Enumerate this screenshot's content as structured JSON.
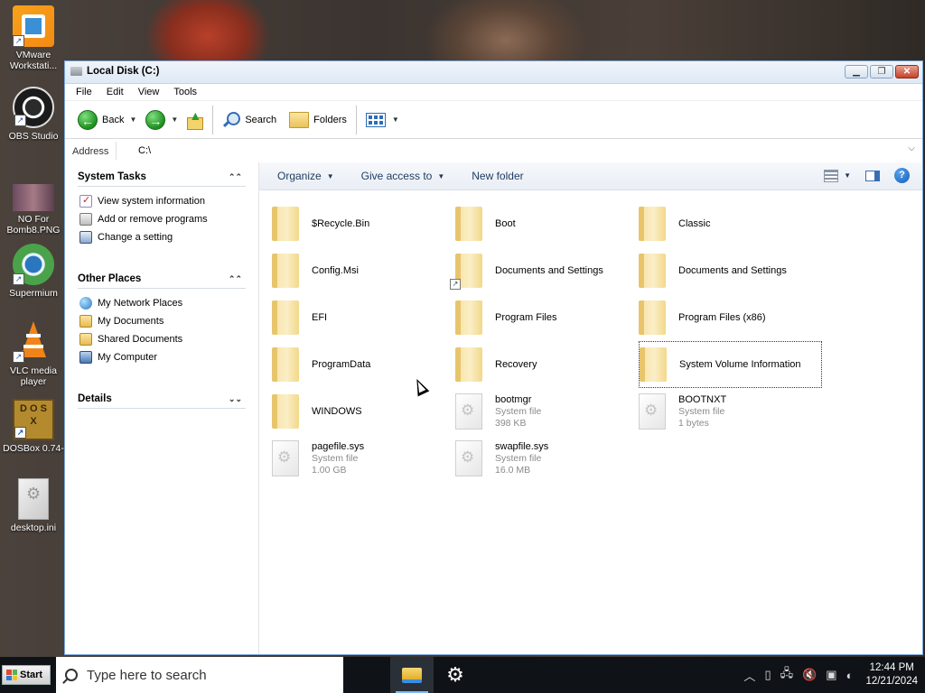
{
  "desktop": {
    "icons": [
      {
        "label": "VMware Workstati...",
        "icon": "vmware-icon"
      },
      {
        "label": "OBS Studio",
        "icon": "obs-icon"
      },
      {
        "label": "NO For Bomb8.PNG",
        "icon": "image-file-icon"
      },
      {
        "label": "Supermium",
        "icon": "supermium-icon"
      },
      {
        "label": "VLC media player",
        "icon": "vlc-icon"
      },
      {
        "label": "DOSBox 0.74-",
        "icon": "dosbox-icon"
      },
      {
        "label": "desktop.ini",
        "icon": "ini-file-icon"
      }
    ]
  },
  "window": {
    "title": "Local Disk (C:)",
    "menu": [
      "File",
      "Edit",
      "View",
      "Tools"
    ],
    "toolbar": {
      "back": "Back",
      "search": "Search",
      "folders": "Folders"
    },
    "address": {
      "label": "Address",
      "value": "C:\\"
    }
  },
  "left_panel": {
    "system_tasks": {
      "title": "System Tasks",
      "items": [
        "View system information",
        "Add or remove programs",
        "Change a setting"
      ]
    },
    "other_places": {
      "title": "Other Places",
      "items": [
        "My Network Places",
        "My Documents",
        "Shared Documents",
        "My Computer"
      ]
    },
    "details": {
      "title": "Details"
    }
  },
  "command_bar": {
    "organize": "Organize",
    "give_access": "Give access to",
    "new_folder": "New folder",
    "help": "?"
  },
  "items": [
    {
      "name": "$Recycle.Bin",
      "type": "folder"
    },
    {
      "name": "Boot",
      "type": "folder"
    },
    {
      "name": "Classic",
      "type": "folder"
    },
    {
      "name": "Config.Msi",
      "type": "folder"
    },
    {
      "name": "Documents and Settings",
      "type": "folder-shortcut"
    },
    {
      "name": "Documents and Settings",
      "type": "folder"
    },
    {
      "name": "EFI",
      "type": "folder"
    },
    {
      "name": "Program Files",
      "type": "folder"
    },
    {
      "name": "Program Files (x86)",
      "type": "folder"
    },
    {
      "name": "ProgramData",
      "type": "folder"
    },
    {
      "name": "Recovery",
      "type": "folder"
    },
    {
      "name": "System Volume Information",
      "type": "folder",
      "selected": true
    },
    {
      "name": "WINDOWS",
      "type": "folder"
    },
    {
      "name": "bootmgr",
      "type": "file",
      "kind": "System file",
      "size": "398 KB"
    },
    {
      "name": "BOOTNXT",
      "type": "file",
      "kind": "System file",
      "size": "1 bytes"
    },
    {
      "name": "pagefile.sys",
      "type": "file",
      "kind": "System file",
      "size": "1.00 GB"
    },
    {
      "name": "swapfile.sys",
      "type": "file",
      "kind": "System file",
      "size": "16.0 MB"
    }
  ],
  "taskbar": {
    "start": "Start",
    "search_placeholder": "Type here to search",
    "time": "12:44 PM",
    "date": "12/21/2024"
  }
}
